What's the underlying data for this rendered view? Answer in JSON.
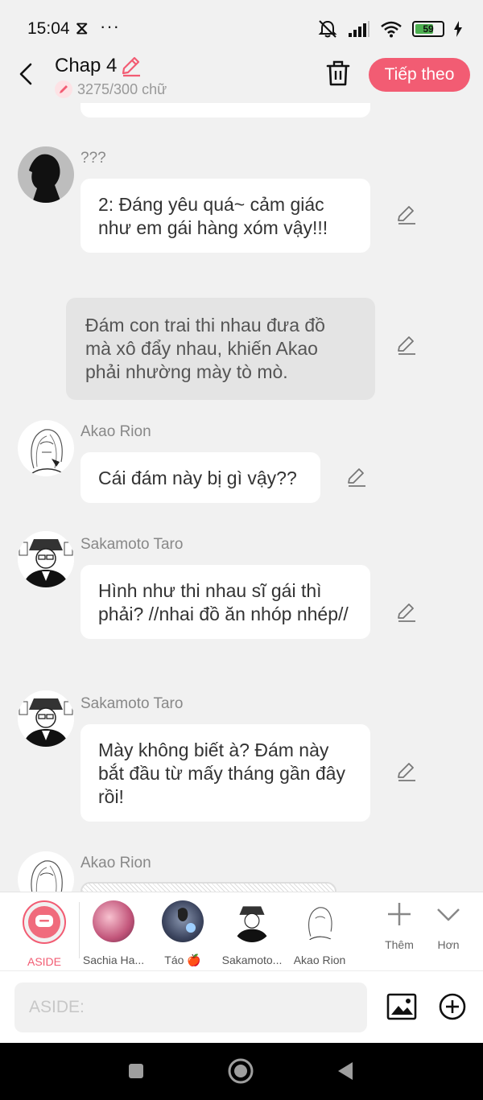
{
  "status": {
    "time": "15:04",
    "dots": "···",
    "battery": "59"
  },
  "header": {
    "title": "Chap 4",
    "word_count": "3275/300 chữ",
    "next_label": "Tiếp theo"
  },
  "messages": [
    {
      "speaker": "???",
      "text": "2: Đáng yêu quá~ cảm giác như em gái hàng xóm vậy!!!"
    },
    {
      "narration": "Đám con trai thi nhau đưa đồ mà xô đẩy nhau, khiến Akao phải nhường mày tò mò."
    },
    {
      "speaker": "Akao Rion",
      "text": "Cái đám này bị gì vậy??"
    },
    {
      "speaker": "Sakamoto Taro",
      "text": "Hình như thi nhau sĩ gái thì phải? //nhai đồ ăn nhóp nhép//"
    },
    {
      "speaker": "Sakamoto Taro",
      "text": "Mày không biết à? Đám này bắt đầu từ mấy tháng gần đây rồi!"
    },
    {
      "speaker": "Akao Rion"
    }
  ],
  "character_bar": {
    "items": [
      {
        "label": "ASIDE"
      },
      {
        "label": "Sachia Ha..."
      },
      {
        "label": "Táo 🍎"
      },
      {
        "label": "Sakamoto..."
      },
      {
        "label": "Akao Rion"
      }
    ],
    "more_label": "Thêm",
    "collapse_label": "Hơn"
  },
  "input": {
    "placeholder": "ASIDE:"
  },
  "colors": {
    "accent": "#f25c73",
    "background": "#f1f1f1",
    "bubble": "#ffffff",
    "narration": "#e4e4e4"
  }
}
